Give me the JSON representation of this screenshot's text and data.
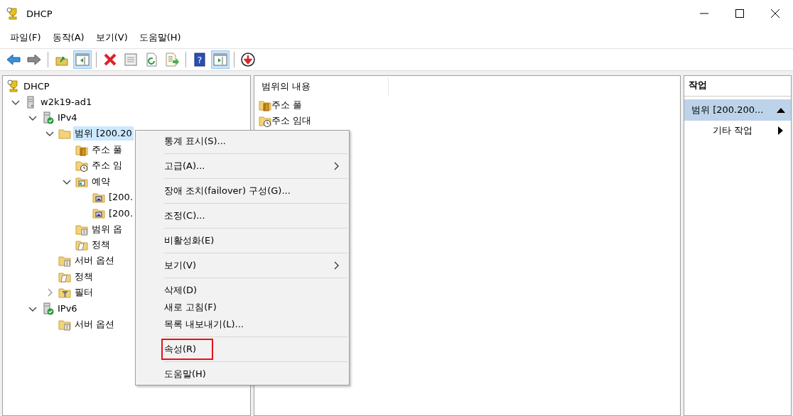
{
  "window": {
    "title": "DHCP"
  },
  "menu_bar": [
    {
      "label": "파일(F)"
    },
    {
      "label": "동작(A)"
    },
    {
      "label": "보기(V)"
    },
    {
      "label": "도움말(H)"
    }
  ],
  "toolbar": [
    {
      "kind": "back",
      "pressed": false
    },
    {
      "kind": "forward",
      "pressed": false
    },
    {
      "kind": "separator"
    },
    {
      "kind": "up",
      "pressed": false
    },
    {
      "kind": "tree-toggle",
      "pressed": true
    },
    {
      "kind": "separator"
    },
    {
      "kind": "delete",
      "pressed": false
    },
    {
      "kind": "properties",
      "pressed": false
    },
    {
      "kind": "refresh",
      "pressed": false
    },
    {
      "kind": "export",
      "pressed": false
    },
    {
      "kind": "separator"
    },
    {
      "kind": "help",
      "glyph": "?",
      "pressed": false
    },
    {
      "kind": "action-toggle",
      "pressed": true
    },
    {
      "kind": "separator"
    },
    {
      "kind": "deactivate",
      "pressed": false
    }
  ],
  "tree": [
    {
      "label": "DHCP",
      "kind": "dhcp",
      "selected": false,
      "children": [
        {
          "label": "w2k19-ad1",
          "kind": "server",
          "expanded": true,
          "selected": false,
          "children": [
            {
              "label": "IPv4",
              "kind": "ip",
              "expanded": true,
              "selected": false,
              "children": [
                {
                  "label": "범위 [200.20",
                  "kind": "folder",
                  "expanded": true,
                  "selected": true,
                  "children": [
                    {
                      "label": "주소 풀",
                      "kind": "pool",
                      "selected": false
                    },
                    {
                      "label": "주소 임",
                      "kind": "lease",
                      "selected": false
                    },
                    {
                      "label": "예약",
                      "kind": "reservation",
                      "expanded": true,
                      "selected": false,
                      "children": [
                        {
                          "label": "[200.",
                          "kind": "reserved",
                          "selected": false
                        },
                        {
                          "label": "[200.",
                          "kind": "reserved",
                          "selected": false
                        }
                      ]
                    },
                    {
                      "label": "범위 옵",
                      "kind": "options",
                      "selected": false
                    },
                    {
                      "label": "정책",
                      "kind": "policy",
                      "selected": false
                    }
                  ]
                },
                {
                  "label": "서버 옵션",
                  "kind": "options",
                  "selected": false
                },
                {
                  "label": "정책",
                  "kind": "policy",
                  "selected": false
                },
                {
                  "label": "필터",
                  "kind": "filter",
                  "expanded": false,
                  "selected": false
                }
              ]
            },
            {
              "label": "IPv6",
              "kind": "ip",
              "expanded": true,
              "selected": false,
              "children": [
                {
                  "label": "서버 옵션",
                  "kind": "options",
                  "selected": false
                }
              ]
            }
          ]
        }
      ]
    }
  ],
  "content": {
    "column": "범위의 내용",
    "items": [
      {
        "label": "주소 풀",
        "kind": "pool"
      },
      {
        "label": "주소 임대",
        "kind": "lease"
      }
    ]
  },
  "actions": {
    "header": "작업",
    "section": {
      "label": "범위 [200.200...",
      "expanded": true
    },
    "items": [
      {
        "label": "기타 작업",
        "has_submenu": true
      }
    ]
  },
  "context_menu": [
    {
      "kind": "item",
      "label": "통계 표시(S)...",
      "has_submenu": false,
      "highlighted": false
    },
    {
      "kind": "separator"
    },
    {
      "kind": "item",
      "label": "고급(A)...",
      "has_submenu": true,
      "highlighted": false
    },
    {
      "kind": "separator"
    },
    {
      "kind": "item",
      "label": "장애 조치(failover) 구성(G)...",
      "has_submenu": false,
      "highlighted": false
    },
    {
      "kind": "separator"
    },
    {
      "kind": "item",
      "label": "조정(C)...",
      "has_submenu": false,
      "highlighted": false
    },
    {
      "kind": "separator"
    },
    {
      "kind": "item",
      "label": "비활성화(E)",
      "has_submenu": false,
      "highlighted": false
    },
    {
      "kind": "separator"
    },
    {
      "kind": "item",
      "label": "보기(V)",
      "has_submenu": true,
      "highlighted": false
    },
    {
      "kind": "separator"
    },
    {
      "kind": "item",
      "label": "삭제(D)",
      "has_submenu": false,
      "highlighted": false
    },
    {
      "kind": "item",
      "label": "새로 고침(F)",
      "has_submenu": false,
      "highlighted": false
    },
    {
      "kind": "item",
      "label": "목록 내보내기(L)...",
      "has_submenu": false,
      "highlighted": false
    },
    {
      "kind": "separator"
    },
    {
      "kind": "item",
      "label": "속성(R)",
      "has_submenu": false,
      "highlighted": true
    },
    {
      "kind": "separator"
    },
    {
      "kind": "item",
      "label": "도움말(H)",
      "has_submenu": false,
      "highlighted": false
    }
  ]
}
